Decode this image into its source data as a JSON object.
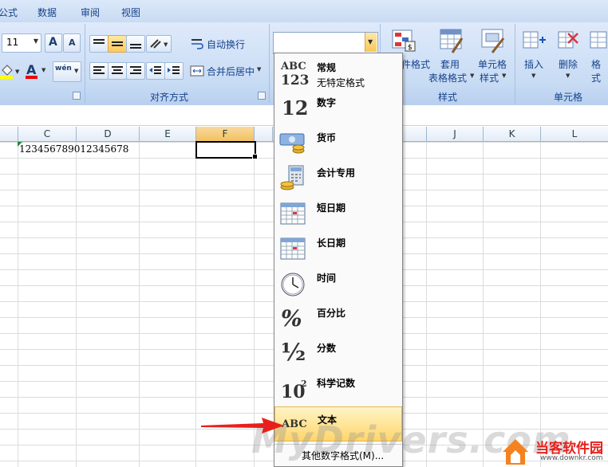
{
  "menubar": {
    "items": [
      "公式",
      "数据",
      "审阅",
      "视图"
    ]
  },
  "ribbon": {
    "font_size": "11",
    "wrap_text": "自动换行",
    "merge_center": "合并后居中",
    "alignment_group": "对齐方式",
    "styles_group": "样式",
    "cells_group": "单元格",
    "cond_format": "件格式",
    "table_format_1": "套用",
    "table_format_2": "表格格式",
    "cell_style_1": "单元格",
    "cell_style_2": "样式",
    "insert": "插入",
    "delete": "删除",
    "format": "格式",
    "font_grow": "A",
    "font_shrink": "A",
    "font_color": "A",
    "phonetic": "wén"
  },
  "columns": [
    "C",
    "D",
    "E",
    "F",
    "",
    "J",
    "K",
    "L"
  ],
  "cell_c1": "123456789012345678",
  "number_format_menu": {
    "items": [
      {
        "label": "常规",
        "sub": "无特定格式",
        "icon": "abc-123-icon"
      },
      {
        "label": "数字",
        "icon": "number-12-icon"
      },
      {
        "label": "货币",
        "icon": "currency-icon"
      },
      {
        "label": "会计专用",
        "icon": "accounting-icon"
      },
      {
        "label": "短日期",
        "icon": "calendar-icon"
      },
      {
        "label": "长日期",
        "icon": "calendar-icon"
      },
      {
        "label": "时间",
        "icon": "clock-icon"
      },
      {
        "label": "百分比",
        "icon": "percent-icon"
      },
      {
        "label": "分数",
        "icon": "fraction-icon"
      },
      {
        "label": "科学记数",
        "icon": "scientific-icon"
      },
      {
        "label": "文本",
        "icon": "abc-text-icon"
      }
    ],
    "more": "其他数字格式(M)...",
    "icon_text": {
      "abc": "ABC",
      "n123": "123",
      "n12": "12",
      "pct": "%",
      "frac": "½",
      "sci": "10",
      "sci_exp": "2"
    }
  },
  "watermark": "MyDrivers.com",
  "site_logo": {
    "name": "当客软件园",
    "url": "www.downkr.com"
  },
  "colors": {
    "highlight": "#ffd66b",
    "arrow": "#e8201c",
    "ribbon_text": "#15428b"
  }
}
